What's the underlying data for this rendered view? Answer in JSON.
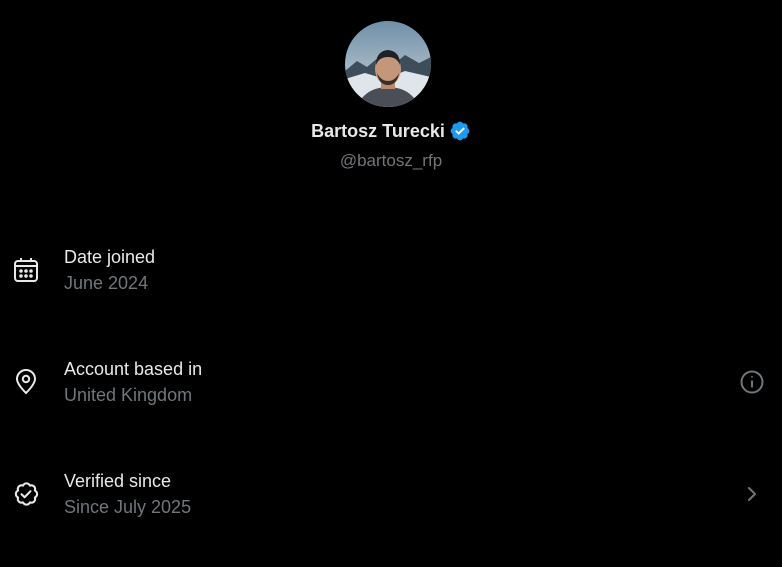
{
  "profile": {
    "display_name": "Bartosz Turecki",
    "handle": "@bartosz_rfp",
    "verified_icon": "verified-badge-icon",
    "verified_color": "#1d9bf0"
  },
  "rows": [
    {
      "icon": "calendar-icon",
      "title": "Date joined",
      "subtitle": "June 2024"
    },
    {
      "icon": "location-pin-icon",
      "title": "Account based in",
      "subtitle": "United Kingdom",
      "action_icon": "info-icon"
    },
    {
      "icon": "verified-outline-icon",
      "title": "Verified since",
      "subtitle": "Since July 2025",
      "action_icon": "chevron-right-icon"
    }
  ],
  "colors": {
    "background": "#000000",
    "primary_text": "#e7e9ea",
    "secondary_text": "#71767b",
    "accent": "#1d9bf0"
  }
}
